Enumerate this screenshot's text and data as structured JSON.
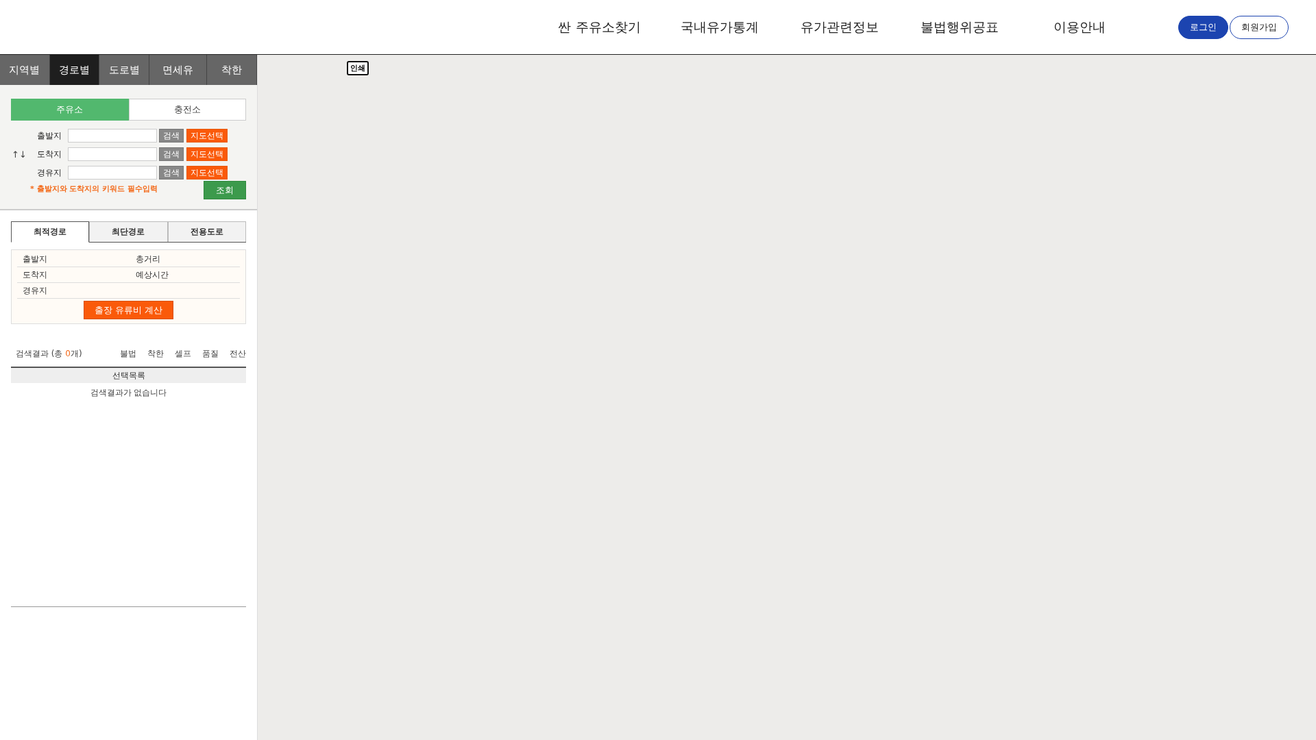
{
  "nav": {
    "items": [
      "싼 주유소찾기",
      "국내유가통계",
      "유가관련정보",
      "불법행위공표",
      "이용안내"
    ],
    "login": "로그인",
    "signup": "회원가입"
  },
  "side_tabs": [
    {
      "label": "지역별",
      "selected": false
    },
    {
      "label": "경로별",
      "selected": true
    },
    {
      "label": "도로별",
      "selected": false
    },
    {
      "label": "면세유",
      "selected": false
    },
    {
      "label": "착한",
      "selected": false
    }
  ],
  "station_types": [
    {
      "label": "주유소",
      "selected": true
    },
    {
      "label": "충전소",
      "selected": false
    }
  ],
  "swap_symbol": "↑↓",
  "route_fields": [
    {
      "label": "출발지",
      "search": "검색",
      "map_pick": "지도선택"
    },
    {
      "label": "도착지",
      "search": "검색",
      "map_pick": "지도선택"
    },
    {
      "label": "경유지",
      "search": "검색",
      "map_pick": "지도선택"
    }
  ],
  "notice": "* 출발지와 도착지의 키워드 필수입력",
  "query_button": "조회",
  "route_tabs": [
    {
      "label": "최적경로",
      "selected": true
    },
    {
      "label": "최단경로",
      "selected": false
    },
    {
      "label": "전용도로",
      "selected": false
    }
  ],
  "summary": {
    "rows": [
      [
        "출발지",
        "총거리"
      ],
      [
        "도착지",
        "예상시간"
      ],
      [
        "경유지",
        ""
      ]
    ],
    "button": "출장 유류비 계산"
  },
  "results": {
    "prefix": "검색결과 (총 ",
    "count": "0",
    "suffix": "개)",
    "filters": [
      "불법",
      "착한",
      "셀프",
      "품질",
      "전산"
    ],
    "list_header": "선택목록",
    "empty": "검색결과가 없습니다"
  },
  "map": {
    "print_button": "인쇄"
  }
}
